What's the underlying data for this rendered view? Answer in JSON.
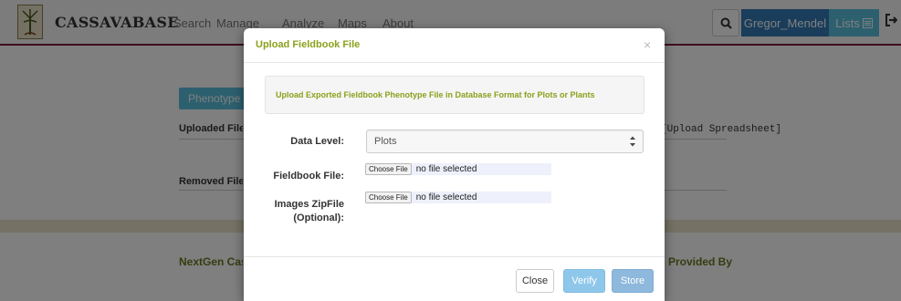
{
  "brand": "CASSAVABASE",
  "nav": [
    "Search",
    "Manage",
    "Analyze",
    "Maps",
    "About"
  ],
  "user": "Gregor_Mendel",
  "lists_label": "Lists",
  "background": {
    "tab_label": "Phenotype Spreadsheet",
    "uploaded_files_label": "Uploaded Files:",
    "removed_files_label": "Removed Files:",
    "spreadsheet_link": "[Upload Spreadsheet]",
    "footer_left": "NextGen Cassava",
    "footer_right": "Provided By"
  },
  "modal": {
    "title": "Upload Fieldbook File",
    "close_symbol": "×",
    "notice": "Upload Exported Fieldbook Phenotype File in Database Format for Plots or Plants",
    "data_level_label": "Data Level:",
    "data_level_value": "Plots",
    "fieldbook_file_label": "Fieldbook File:",
    "images_zip_label_line1": "Images ZipFile",
    "images_zip_label_line2": "(Optional):",
    "choose_file": "Choose File",
    "no_file": "no file selected",
    "buttons": {
      "close": "Close",
      "verify": "Verify",
      "store": "Store"
    }
  },
  "colors": {
    "accent_green": "#8aa11b",
    "primary_blue": "#337ab7",
    "info_blue": "#5bc0de"
  }
}
